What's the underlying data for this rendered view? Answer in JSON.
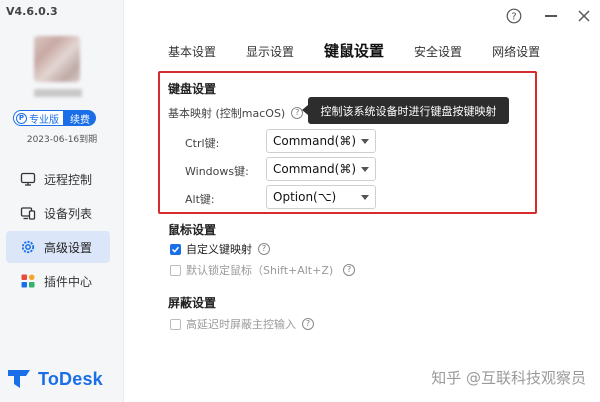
{
  "app": {
    "version": "V4.6.0.3",
    "name": "ToDesk"
  },
  "account": {
    "pro_label": "专业版",
    "pro_icon_letter": "P",
    "renew_label": "续费",
    "expire_text": "2023-06-16到期"
  },
  "sidebar": {
    "items": [
      {
        "label": "远程控制",
        "icon": "monitor-icon",
        "active": false
      },
      {
        "label": "设备列表",
        "icon": "devices-icon",
        "active": false
      },
      {
        "label": "高级设置",
        "icon": "settings-gear-icon",
        "active": true
      },
      {
        "label": "插件中心",
        "icon": "plugin-grid-icon",
        "active": false
      }
    ]
  },
  "window": {
    "help": "?",
    "minimize": "—",
    "close": "✕"
  },
  "tabs": [
    "基本设置",
    "显示设置",
    "键鼠设置",
    "安全设置",
    "网络设置"
  ],
  "active_tab": "键鼠设置",
  "keyboard": {
    "title": "键盘设置",
    "mapping_label": "基本映射 (控制macOS)",
    "tooltip": "控制该系统设备时进行键盘按键映射",
    "rows": [
      {
        "label": "Ctrl键:",
        "value": "Command(⌘)"
      },
      {
        "label": "Windows键:",
        "value": "Command(⌘)"
      },
      {
        "label": "Alt键:",
        "value": "Option(⌥)"
      }
    ]
  },
  "mouse": {
    "title": "鼠标设置",
    "options": [
      {
        "label": "自定义键映射",
        "checked": true,
        "enabled": true
      },
      {
        "label": "默认锁定鼠标（Shift+Alt+Z)",
        "checked": false,
        "enabled": false
      }
    ]
  },
  "screen": {
    "title": "屏蔽设置",
    "options": [
      {
        "label": "高延迟时屏蔽主控输入",
        "checked": false,
        "enabled": false
      }
    ]
  },
  "watermark": "知乎 @互联科技观察员",
  "colors": {
    "accent": "#1a6fe8",
    "highlight_border": "#d82b2b",
    "active_nav_bg": "#dbe6f8",
    "tooltip_bg": "#2d2d2d"
  }
}
